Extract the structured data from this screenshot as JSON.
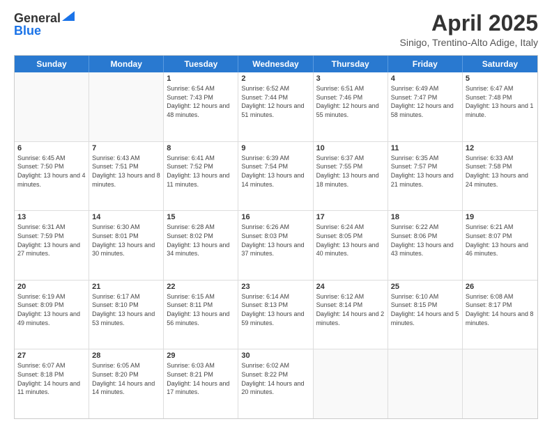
{
  "header": {
    "logo_general": "General",
    "logo_blue": "Blue",
    "month_title": "April 2025",
    "subtitle": "Sinigo, Trentino-Alto Adige, Italy"
  },
  "calendar": {
    "days_of_week": [
      "Sunday",
      "Monday",
      "Tuesday",
      "Wednesday",
      "Thursday",
      "Friday",
      "Saturday"
    ],
    "rows": [
      [
        {
          "day": "",
          "info": ""
        },
        {
          "day": "",
          "info": ""
        },
        {
          "day": "1",
          "info": "Sunrise: 6:54 AM\nSunset: 7:43 PM\nDaylight: 12 hours and 48 minutes."
        },
        {
          "day": "2",
          "info": "Sunrise: 6:52 AM\nSunset: 7:44 PM\nDaylight: 12 hours and 51 minutes."
        },
        {
          "day": "3",
          "info": "Sunrise: 6:51 AM\nSunset: 7:46 PM\nDaylight: 12 hours and 55 minutes."
        },
        {
          "day": "4",
          "info": "Sunrise: 6:49 AM\nSunset: 7:47 PM\nDaylight: 12 hours and 58 minutes."
        },
        {
          "day": "5",
          "info": "Sunrise: 6:47 AM\nSunset: 7:48 PM\nDaylight: 13 hours and 1 minute."
        }
      ],
      [
        {
          "day": "6",
          "info": "Sunrise: 6:45 AM\nSunset: 7:50 PM\nDaylight: 13 hours and 4 minutes."
        },
        {
          "day": "7",
          "info": "Sunrise: 6:43 AM\nSunset: 7:51 PM\nDaylight: 13 hours and 8 minutes."
        },
        {
          "day": "8",
          "info": "Sunrise: 6:41 AM\nSunset: 7:52 PM\nDaylight: 13 hours and 11 minutes."
        },
        {
          "day": "9",
          "info": "Sunrise: 6:39 AM\nSunset: 7:54 PM\nDaylight: 13 hours and 14 minutes."
        },
        {
          "day": "10",
          "info": "Sunrise: 6:37 AM\nSunset: 7:55 PM\nDaylight: 13 hours and 18 minutes."
        },
        {
          "day": "11",
          "info": "Sunrise: 6:35 AM\nSunset: 7:57 PM\nDaylight: 13 hours and 21 minutes."
        },
        {
          "day": "12",
          "info": "Sunrise: 6:33 AM\nSunset: 7:58 PM\nDaylight: 13 hours and 24 minutes."
        }
      ],
      [
        {
          "day": "13",
          "info": "Sunrise: 6:31 AM\nSunset: 7:59 PM\nDaylight: 13 hours and 27 minutes."
        },
        {
          "day": "14",
          "info": "Sunrise: 6:30 AM\nSunset: 8:01 PM\nDaylight: 13 hours and 30 minutes."
        },
        {
          "day": "15",
          "info": "Sunrise: 6:28 AM\nSunset: 8:02 PM\nDaylight: 13 hours and 34 minutes."
        },
        {
          "day": "16",
          "info": "Sunrise: 6:26 AM\nSunset: 8:03 PM\nDaylight: 13 hours and 37 minutes."
        },
        {
          "day": "17",
          "info": "Sunrise: 6:24 AM\nSunset: 8:05 PM\nDaylight: 13 hours and 40 minutes."
        },
        {
          "day": "18",
          "info": "Sunrise: 6:22 AM\nSunset: 8:06 PM\nDaylight: 13 hours and 43 minutes."
        },
        {
          "day": "19",
          "info": "Sunrise: 6:21 AM\nSunset: 8:07 PM\nDaylight: 13 hours and 46 minutes."
        }
      ],
      [
        {
          "day": "20",
          "info": "Sunrise: 6:19 AM\nSunset: 8:09 PM\nDaylight: 13 hours and 49 minutes."
        },
        {
          "day": "21",
          "info": "Sunrise: 6:17 AM\nSunset: 8:10 PM\nDaylight: 13 hours and 53 minutes."
        },
        {
          "day": "22",
          "info": "Sunrise: 6:15 AM\nSunset: 8:11 PM\nDaylight: 13 hours and 56 minutes."
        },
        {
          "day": "23",
          "info": "Sunrise: 6:14 AM\nSunset: 8:13 PM\nDaylight: 13 hours and 59 minutes."
        },
        {
          "day": "24",
          "info": "Sunrise: 6:12 AM\nSunset: 8:14 PM\nDaylight: 14 hours and 2 minutes."
        },
        {
          "day": "25",
          "info": "Sunrise: 6:10 AM\nSunset: 8:15 PM\nDaylight: 14 hours and 5 minutes."
        },
        {
          "day": "26",
          "info": "Sunrise: 6:08 AM\nSunset: 8:17 PM\nDaylight: 14 hours and 8 minutes."
        }
      ],
      [
        {
          "day": "27",
          "info": "Sunrise: 6:07 AM\nSunset: 8:18 PM\nDaylight: 14 hours and 11 minutes."
        },
        {
          "day": "28",
          "info": "Sunrise: 6:05 AM\nSunset: 8:20 PM\nDaylight: 14 hours and 14 minutes."
        },
        {
          "day": "29",
          "info": "Sunrise: 6:03 AM\nSunset: 8:21 PM\nDaylight: 14 hours and 17 minutes."
        },
        {
          "day": "30",
          "info": "Sunrise: 6:02 AM\nSunset: 8:22 PM\nDaylight: 14 hours and 20 minutes."
        },
        {
          "day": "",
          "info": ""
        },
        {
          "day": "",
          "info": ""
        },
        {
          "day": "",
          "info": ""
        }
      ]
    ]
  }
}
